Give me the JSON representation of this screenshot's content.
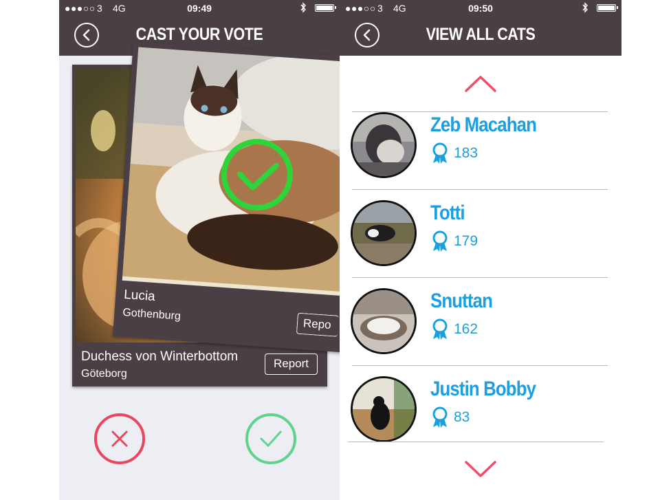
{
  "left_screen": {
    "status": {
      "signal": "●●●○○",
      "carrier": "3",
      "network": "4G",
      "time": "09:49"
    },
    "title": "CAST YOUR VOTE",
    "front_card": {
      "name": "Lucia",
      "location": "Gothenburg",
      "report_label": "Repo"
    },
    "back_card": {
      "name": "Duchess von Winterbottom",
      "location": "Göteborg",
      "report_label": "Report"
    },
    "buttons": {
      "reject_icon": "close-icon",
      "accept_icon": "check-icon"
    },
    "colors": {
      "reject": "#e9475f",
      "accept": "#5fd28b",
      "bar": "#4a3f45"
    }
  },
  "right_screen": {
    "status": {
      "signal": "●●●○○",
      "carrier": "3",
      "network": "4G",
      "time": "09:50"
    },
    "title": "VIEW ALL CATS",
    "cats": [
      {
        "name": "Zeb Macahan",
        "votes": "183"
      },
      {
        "name": "Totti",
        "votes": "179"
      },
      {
        "name": "Snuttan",
        "votes": "162"
      },
      {
        "name": "Justin Bobby",
        "votes": "83"
      }
    ],
    "colors": {
      "accent": "#1b9fe0",
      "arrows": "#ef4d6b"
    }
  }
}
